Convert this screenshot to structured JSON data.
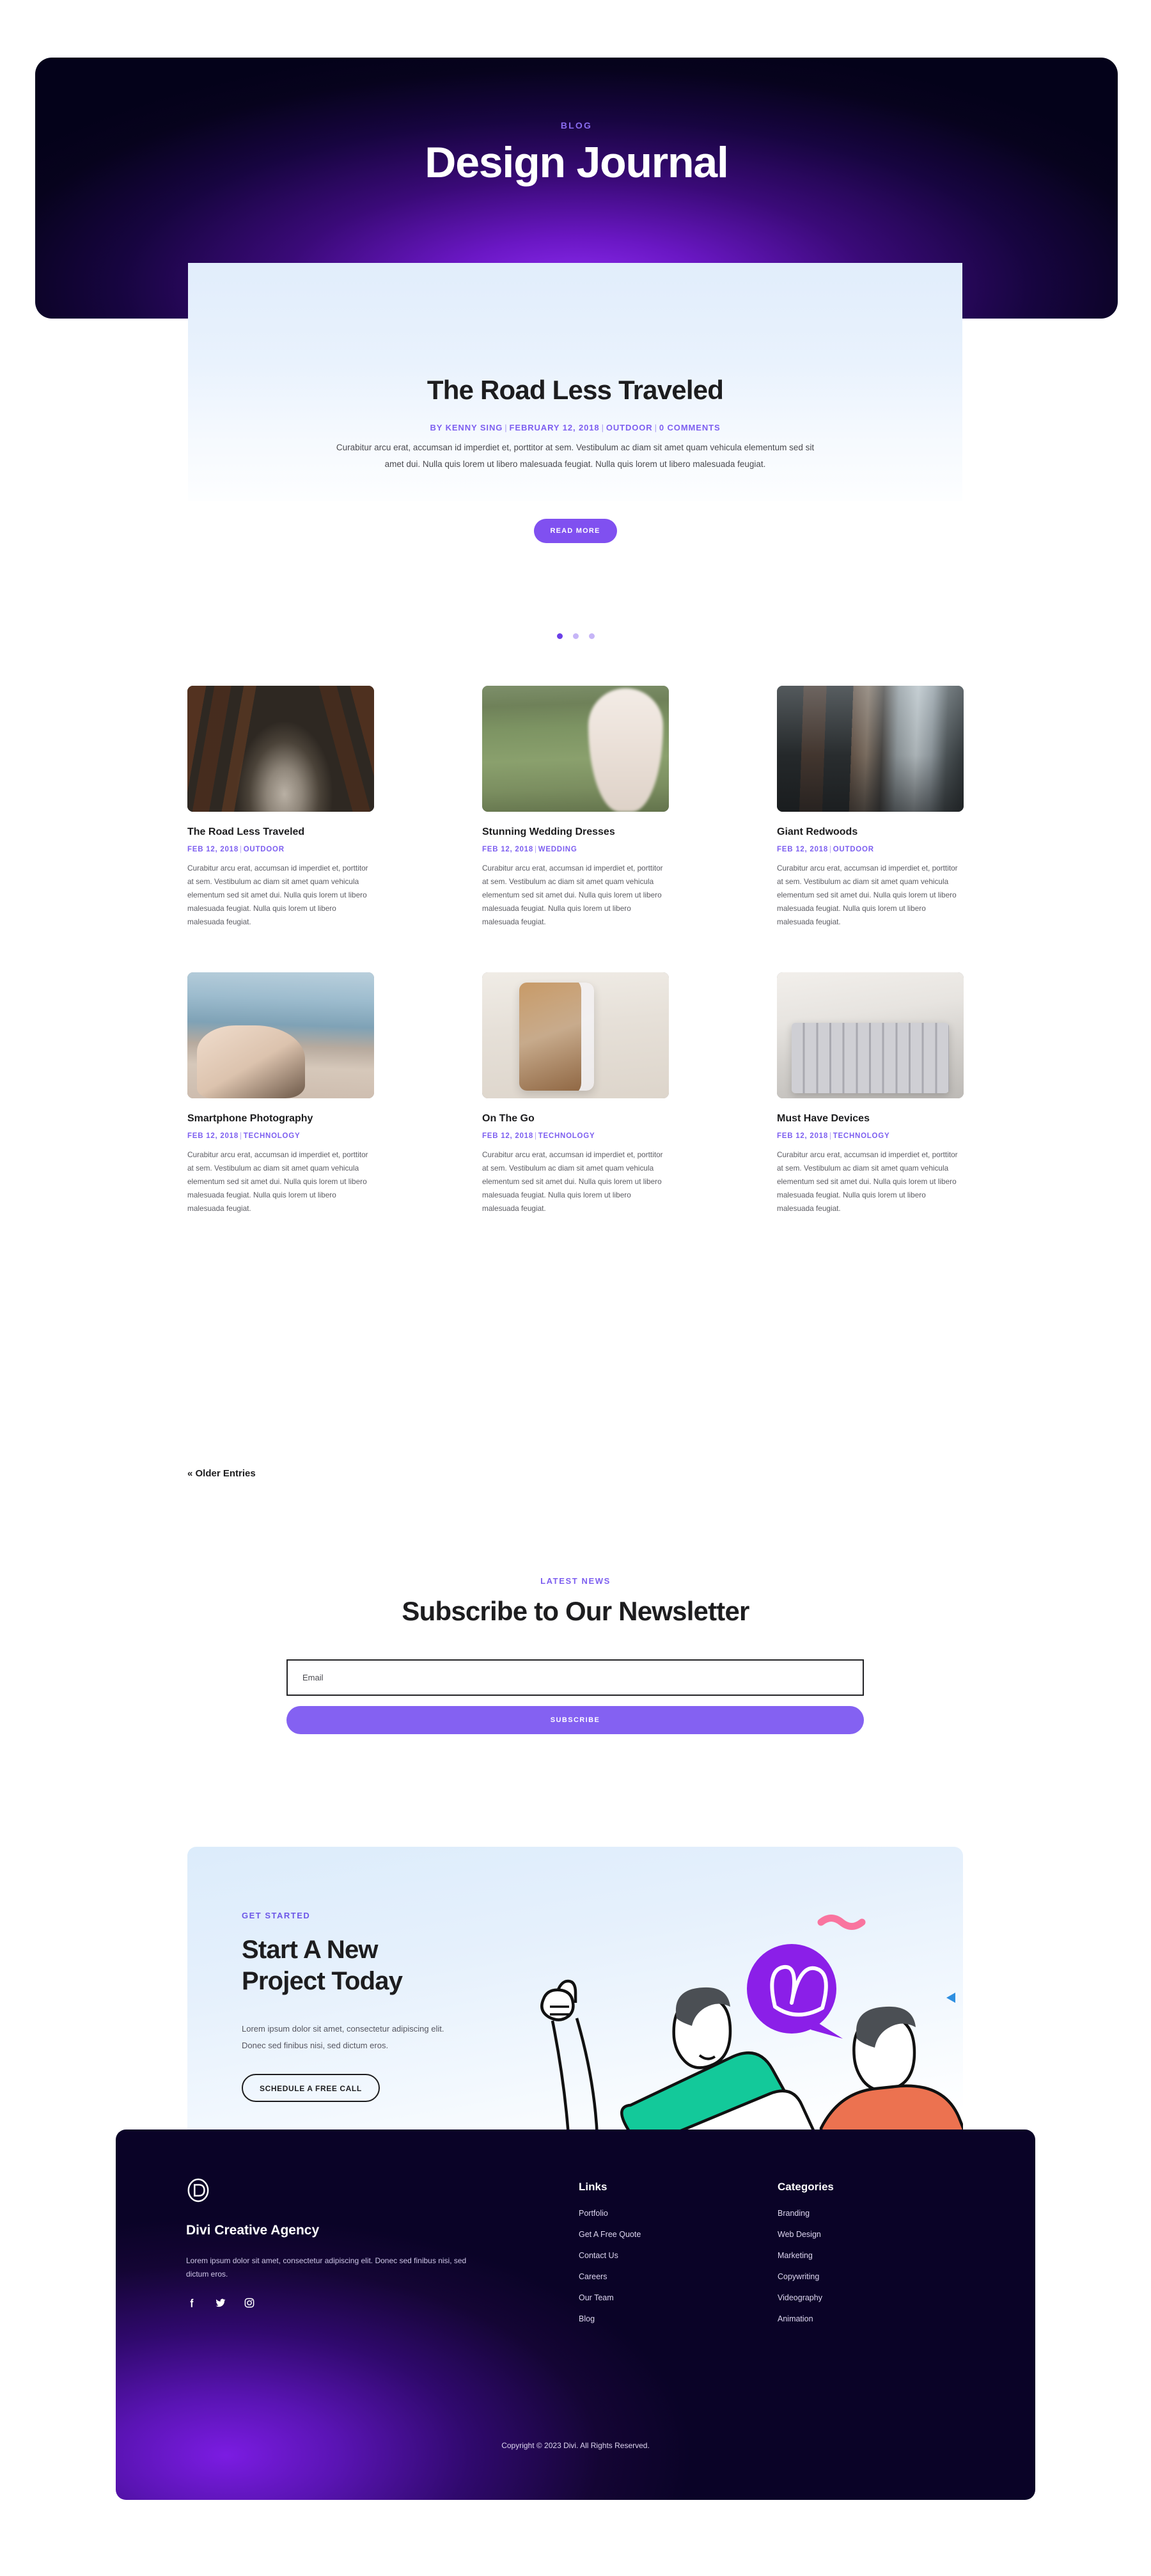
{
  "hero": {
    "eyebrow": "BLOG",
    "title": "Design Journal"
  },
  "featured": {
    "title": "The Road Less Traveled",
    "meta": {
      "author": "BY KENNY SING",
      "date": "FEBRUARY 12, 2018",
      "category": "OUTDOOR",
      "comments": "0 COMMENTS"
    },
    "excerpt": "Curabitur arcu erat, accumsan id imperdiet et, porttitor at sem. Vestibulum ac diam sit amet quam vehicula elementum sed sit amet dui. Nulla quis lorem ut libero malesuada feugiat. Nulla quis lorem ut libero malesuada feugiat.",
    "read_more_label": "READ MORE"
  },
  "slider": {
    "dots": 3,
    "active_index": 0
  },
  "posts": [
    {
      "title": "The Road Less Traveled",
      "date": "FEB 12, 2018",
      "category": "OUTDOOR",
      "excerpt": "Curabitur arcu erat, accumsan id imperdiet et, porttitor at sem. Vestibulum ac diam sit amet quam vehicula elementum sed sit amet dui. Nulla quis lorem ut libero malesuada feugiat. Nulla quis lorem ut libero malesuada feugiat.",
      "image": "forest-road-photo"
    },
    {
      "title": "Stunning Wedding Dresses",
      "date": "FEB 12, 2018",
      "category": "WEDDING",
      "excerpt": "Curabitur arcu erat, accumsan id imperdiet et, porttitor at sem. Vestibulum ac diam sit amet quam vehicula elementum sed sit amet dui. Nulla quis lorem ut libero malesuada feugiat. Nulla quis lorem ut libero malesuada feugiat.",
      "image": "bride-in-field-photo"
    },
    {
      "title": "Giant Redwoods",
      "date": "FEB 12, 2018",
      "category": "OUTDOOR",
      "excerpt": "Curabitur arcu erat, accumsan id imperdiet et, porttitor at sem. Vestibulum ac diam sit amet quam vehicula elementum sed sit amet dui. Nulla quis lorem ut libero malesuada feugiat. Nulla quis lorem ut libero malesuada feugiat.",
      "image": "redwood-trees-photo"
    },
    {
      "title": "Smartphone Photography",
      "date": "FEB 12, 2018",
      "category": "TECHNOLOGY",
      "excerpt": "Curabitur arcu erat, accumsan id imperdiet et, porttitor at sem. Vestibulum ac diam sit amet quam vehicula elementum sed sit amet dui. Nulla quis lorem ut libero malesuada feugiat. Nulla quis lorem ut libero malesuada feugiat.",
      "image": "hands-holding-camera-photo"
    },
    {
      "title": "On The Go",
      "date": "FEB 12, 2018",
      "category": "TECHNOLOGY",
      "excerpt": "Curabitur arcu erat, accumsan id imperdiet et, porttitor at sem. Vestibulum ac diam sit amet quam vehicula elementum sed sit amet dui. Nulla quis lorem ut libero malesuada feugiat. Nulla quis lorem ut libero malesuada feugiat.",
      "image": "phone-on-leather-case-photo"
    },
    {
      "title": "Must Have Devices",
      "date": "FEB 12, 2018",
      "category": "TECHNOLOGY",
      "excerpt": "Curabitur arcu erat, accumsan id imperdiet et, porttitor at sem. Vestibulum ac diam sit amet quam vehicula elementum sed sit amet dui. Nulla quis lorem ut libero malesuada feugiat. Nulla quis lorem ut libero malesuada feugiat.",
      "image": "laptop-keyboard-photo"
    }
  ],
  "pagination": {
    "older_label": "« Older Entries"
  },
  "newsletter": {
    "eyebrow": "LATEST NEWS",
    "title": "Subscribe to Our Newsletter",
    "email_placeholder": "Email",
    "email_value": "",
    "subscribe_label": "SUBSCRIBE"
  },
  "cta": {
    "eyebrow": "GET STARTED",
    "title": "Start A New Project Today",
    "body": "Lorem ipsum dolor sit amet, consectetur adipiscing elit. Donec sed finibus nisi, sed dictum eros.",
    "button_label": "SCHEDULE A FREE CALL",
    "illustration": "two-people-with-laptop-and-speech-bubble"
  },
  "footer": {
    "logo": "divi-d-logo",
    "brand": "Divi Creative Agency",
    "description": "Lorem ipsum dolor sit amet, consectetur adipiscing elit. Donec sed finibus nisi, sed dictum eros.",
    "socials": [
      "facebook-icon",
      "twitter-icon",
      "instagram-icon"
    ],
    "columns": [
      {
        "heading": "Links",
        "items": [
          "Portfolio",
          "Get A Free Quote",
          "Contact Us",
          "Careers",
          "Our Team",
          "Blog"
        ]
      },
      {
        "heading": "Categories",
        "items": [
          "Branding",
          "Web Design",
          "Marketing",
          "Copywriting",
          "Videography",
          "Animation"
        ]
      }
    ],
    "copyright": "Copyright © 2023 Divi. All Rights Reserved."
  },
  "colors": {
    "accent_purple": "#7d5ff0",
    "button_purple": "#8050f0",
    "hero_dark": "#07031c",
    "text_dark": "#1d1d1f"
  }
}
